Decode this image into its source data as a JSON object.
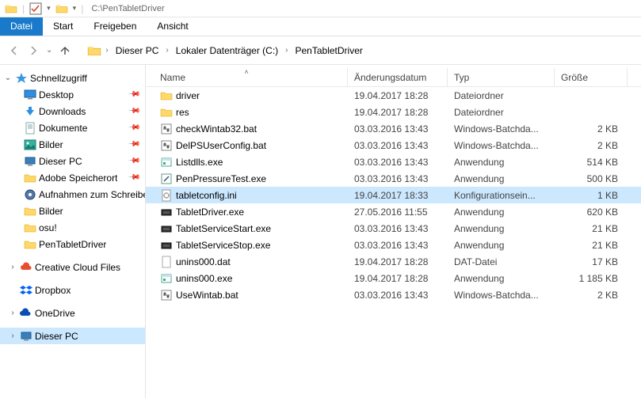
{
  "titlebar": {
    "path": "C:\\PenTabletDriver"
  },
  "ribbon": {
    "file": "Datei",
    "start": "Start",
    "share": "Freigeben",
    "view": "Ansicht"
  },
  "breadcrumb": {
    "pc": "Dieser PC",
    "drive": "Lokaler Datenträger (C:)",
    "folder": "PenTabletDriver"
  },
  "cols": {
    "name": "Name",
    "date": "Änderungsdatum",
    "type": "Typ",
    "size": "Größe"
  },
  "sidebar": {
    "quickaccess": "Schnellzugriff",
    "desktop": "Desktop",
    "downloads": "Downloads",
    "documents": "Dokumente",
    "pictures": "Bilder",
    "thispc": "Dieser PC",
    "adobe": "Adobe Speicherort",
    "record": "Aufnahmen zum Schreiben",
    "bilder2": "Bilder",
    "osu": "osu!",
    "ptd": "PenTabletDriver",
    "ccf": "Creative Cloud Files",
    "dropbox": "Dropbox",
    "onedrive": "OneDrive",
    "dieserpc": "Dieser PC"
  },
  "files": [
    {
      "icon": "folder",
      "name": "driver",
      "date": "19.04.2017 18:28",
      "type": "Dateiordner",
      "size": ""
    },
    {
      "icon": "folder",
      "name": "res",
      "date": "19.04.2017 18:28",
      "type": "Dateiordner",
      "size": ""
    },
    {
      "icon": "bat",
      "name": "checkWintab32.bat",
      "date": "03.03.2016 13:43",
      "type": "Windows-Batchda...",
      "size": "2 KB"
    },
    {
      "icon": "bat",
      "name": "DelPSUserConfig.bat",
      "date": "03.03.2016 13:43",
      "type": "Windows-Batchda...",
      "size": "2 KB"
    },
    {
      "icon": "exe",
      "name": "Listdlls.exe",
      "date": "03.03.2016 13:43",
      "type": "Anwendung",
      "size": "514 KB"
    },
    {
      "icon": "pen",
      "name": "PenPressureTest.exe",
      "date": "03.03.2016 13:43",
      "type": "Anwendung",
      "size": "500 KB"
    },
    {
      "icon": "ini",
      "name": "tabletconfig.ini",
      "date": "19.04.2017 18:33",
      "type": "Konfigurationsein...",
      "size": "1 KB",
      "selected": true
    },
    {
      "icon": "tbl",
      "name": "TabletDriver.exe",
      "date": "27.05.2016 11:55",
      "type": "Anwendung",
      "size": "620 KB"
    },
    {
      "icon": "tbl",
      "name": "TabletServiceStart.exe",
      "date": "03.03.2016 13:43",
      "type": "Anwendung",
      "size": "21 KB"
    },
    {
      "icon": "tbl",
      "name": "TabletServiceStop.exe",
      "date": "03.03.2016 13:43",
      "type": "Anwendung",
      "size": "21 KB"
    },
    {
      "icon": "dat",
      "name": "unins000.dat",
      "date": "19.04.2017 18:28",
      "type": "DAT-Datei",
      "size": "17 KB"
    },
    {
      "icon": "exe",
      "name": "unins000.exe",
      "date": "19.04.2017 18:28",
      "type": "Anwendung",
      "size": "1 185 KB"
    },
    {
      "icon": "bat",
      "name": "UseWintab.bat",
      "date": "03.03.2016 13:43",
      "type": "Windows-Batchda...",
      "size": "2 KB"
    }
  ]
}
